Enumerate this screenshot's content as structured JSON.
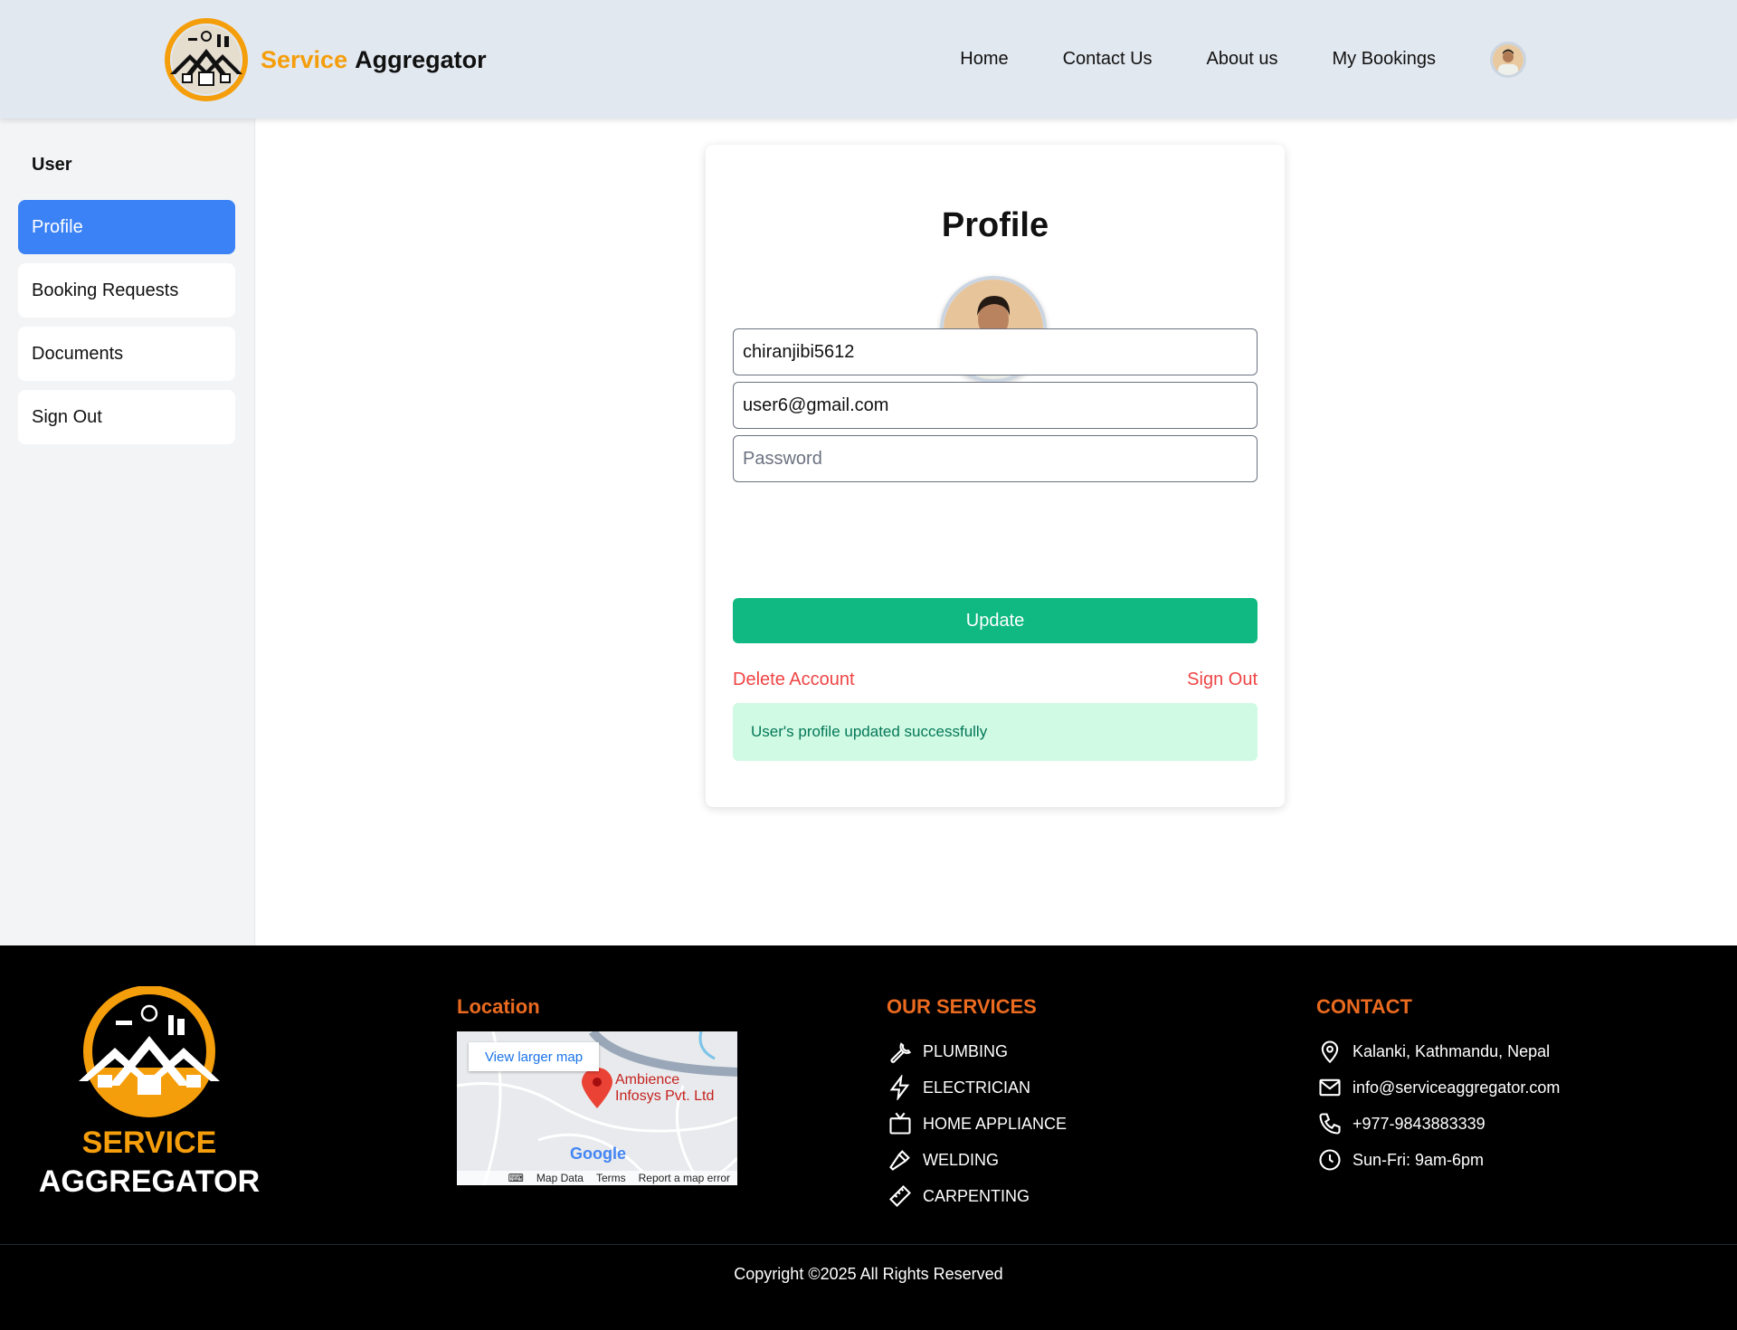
{
  "header": {
    "brand_part1": "Service",
    "brand_part2": "Aggregator",
    "nav": [
      "Home",
      "Contact Us",
      "About us",
      "My Bookings"
    ]
  },
  "sidebar": {
    "title": "User",
    "items": [
      {
        "label": "Profile",
        "active": true
      },
      {
        "label": "Booking Requests",
        "active": false
      },
      {
        "label": "Documents",
        "active": false
      },
      {
        "label": "Sign Out",
        "active": false
      }
    ]
  },
  "profile": {
    "title": "Profile",
    "username_value": "chiranjibi5612",
    "email_value": "user6@gmail.com",
    "password_placeholder": "Password",
    "update_label": "Update",
    "delete_label": "Delete Account",
    "signout_label": "Sign Out",
    "success_message": "User's profile updated successfully"
  },
  "footer": {
    "logo_line1": "SERVICE",
    "logo_line2": "AGGREGATOR",
    "location_heading": "Location",
    "map": {
      "view_larger": "View larger map",
      "place_line1": "Ambience",
      "place_line2": "Infosys Pvt. Ltd",
      "google": "Google",
      "map_data": "Map Data",
      "terms": "Terms",
      "report": "Report a map error"
    },
    "services_heading": "OUR SERVICES",
    "services": [
      {
        "label": "PLUMBING",
        "icon": "wrench-icon"
      },
      {
        "label": "ELECTRICIAN",
        "icon": "lightning-icon"
      },
      {
        "label": "HOME APPLIANCE",
        "icon": "tv-icon"
      },
      {
        "label": "WELDING",
        "icon": "hammer-icon"
      },
      {
        "label": "CARPENTING",
        "icon": "ruler-icon"
      }
    ],
    "contact_heading": "CONTACT",
    "contact": [
      {
        "label": "Kalanki, Kathmandu, Nepal",
        "icon": "location-pin-icon"
      },
      {
        "label": "info@serviceaggregator.com",
        "icon": "mail-icon"
      },
      {
        "label": "+977-9843883339",
        "icon": "phone-icon"
      },
      {
        "label": "Sun-Fri: 9am-6pm",
        "icon": "clock-icon"
      }
    ],
    "copyright": "Copyright ©2025 All Rights Reserved"
  },
  "colors": {
    "accent_orange": "#f59e0b",
    "primary_blue": "#3b82f6",
    "success_green": "#10b981",
    "danger_red": "#ef4444",
    "footer_heading": "#ea6a1f"
  }
}
